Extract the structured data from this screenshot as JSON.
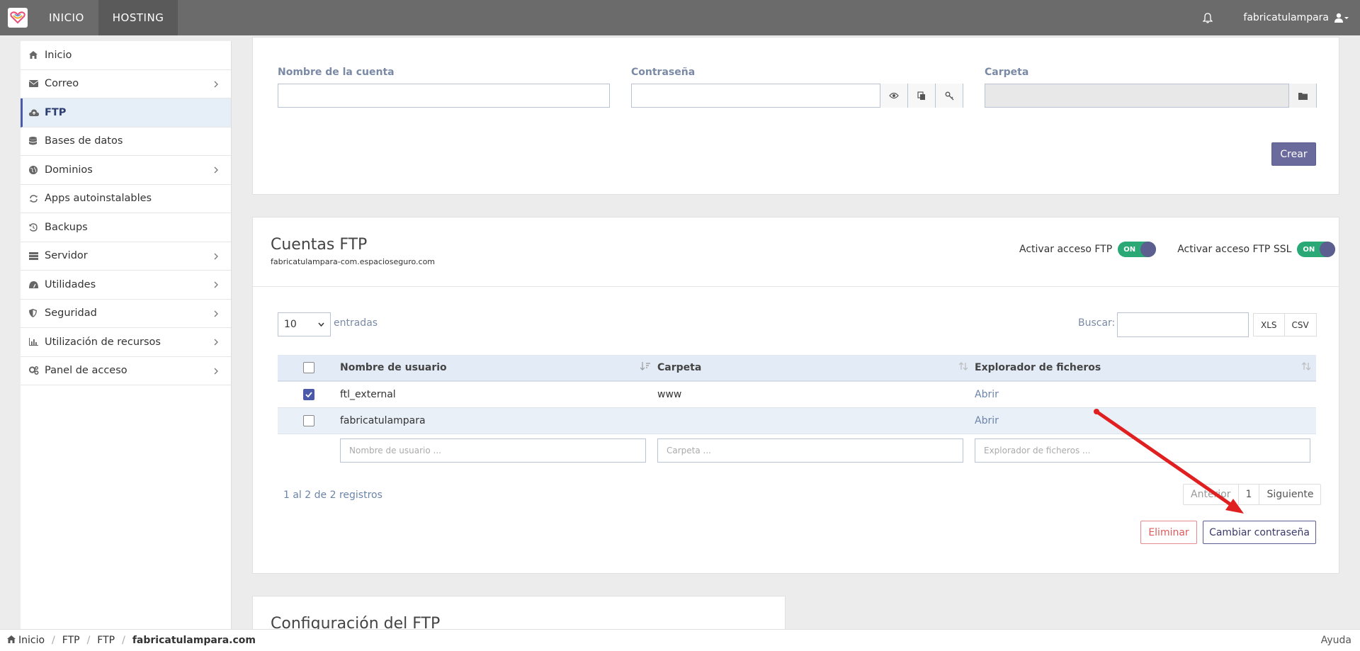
{
  "topbar": {
    "nav": [
      "INICIO",
      "HOSTING"
    ],
    "username": "fabricatulampara"
  },
  "sidebar": {
    "items": [
      {
        "label": "Inicio",
        "icon": "home-icon",
        "has_children": false
      },
      {
        "label": "Correo",
        "icon": "envelope-icon",
        "has_children": true
      },
      {
        "label": "FTP",
        "icon": "cloud-upload-icon",
        "has_children": false,
        "active": true
      },
      {
        "label": "Bases de datos",
        "icon": "database-icon",
        "has_children": false
      },
      {
        "label": "Dominios",
        "icon": "globe-icon",
        "has_children": true
      },
      {
        "label": "Apps autoinstalables",
        "icon": "refresh-icon",
        "has_children": false
      },
      {
        "label": "Backups",
        "icon": "history-icon",
        "has_children": false
      },
      {
        "label": "Servidor",
        "icon": "server-icon",
        "has_children": true
      },
      {
        "label": "Utilidades",
        "icon": "dashboard-icon",
        "has_children": true
      },
      {
        "label": "Seguridad",
        "icon": "shield-icon",
        "has_children": true
      },
      {
        "label": "Utilización de recursos",
        "icon": "bar-chart-icon",
        "has_children": true
      },
      {
        "label": "Panel de acceso",
        "icon": "cogs-icon",
        "has_children": true
      }
    ]
  },
  "create_form": {
    "account_label": "Nombre de la cuenta",
    "password_label": "Contraseña",
    "folder_label": "Carpeta",
    "create_button": "Crear"
  },
  "ftp_accounts": {
    "title": "Cuentas FTP",
    "host": "fabricatulampara-com.espacioseguro.com",
    "toggle_ftp_label": "Activar acceso FTP",
    "toggle_ftps_label": "Activar acceso FTP SSL",
    "toggle_ftp_state": "ON",
    "toggle_ftps_state": "ON",
    "page_size": "10",
    "entries_label": "entradas",
    "search_label": "Buscar:",
    "xls_button": "XLS",
    "csv_button": "CSV",
    "columns": [
      "Nombre de usuario",
      "Carpeta",
      "Explorador de ficheros"
    ],
    "rows": [
      {
        "checked": true,
        "user": "ftl_external",
        "folder": "www",
        "explorer": "Abrir"
      },
      {
        "checked": false,
        "user": "fabricatulampara",
        "folder": "",
        "explorer": "Abrir"
      }
    ],
    "filters": [
      "Nombre de usuario ...",
      "Carpeta ...",
      "Explorador de ficheros ..."
    ],
    "info": "1 al 2 de 2 registros",
    "pager": {
      "prev": "Anterior",
      "page": "1",
      "next": "Siguiente"
    },
    "delete_button": "Eliminar",
    "change_password_button": "Cambiar contraseña"
  },
  "config_panel": {
    "title": "Configuración del FTP"
  },
  "footer": {
    "breadcrumb": [
      "Inicio",
      "FTP",
      "FTP",
      "fabricatulampara.com"
    ],
    "help": "Ayuda"
  },
  "colors": {
    "topbar": "#6b6b6b",
    "primary": "#6a6a9c",
    "toggle_on": "#2aa876",
    "danger": "#e05a5a",
    "annotation_arrow": "#e02020"
  }
}
